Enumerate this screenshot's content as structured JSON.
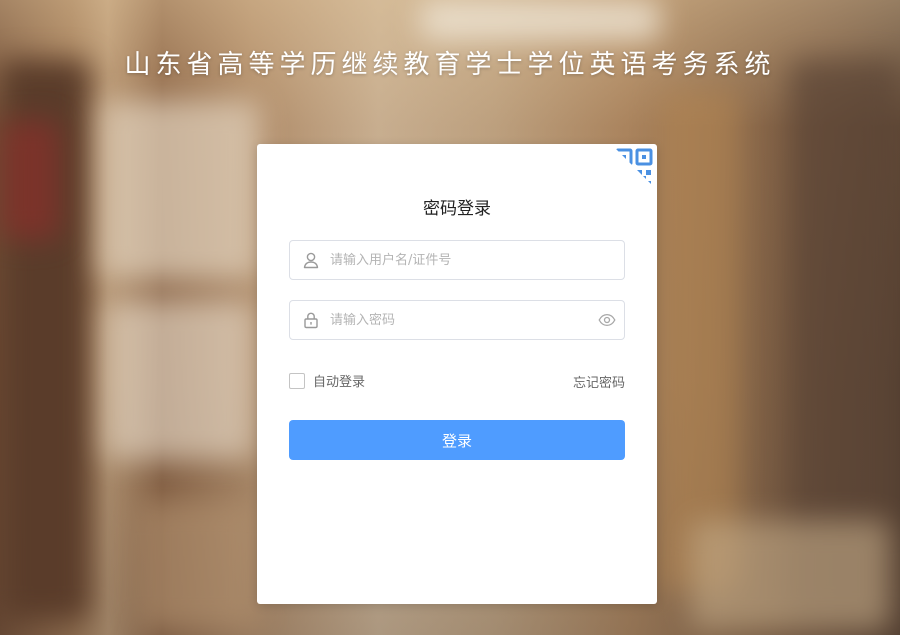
{
  "page": {
    "title": "山东省高等学历继续教育学士学位英语考务系统"
  },
  "login": {
    "heading": "密码登录",
    "username": {
      "value": "",
      "placeholder": "请输入用户名/证件号",
      "icon": "user-icon"
    },
    "password": {
      "value": "",
      "placeholder": "请输入密码",
      "icon": "lock-icon",
      "toggle_icon": "eye-icon"
    },
    "remember_label": "自动登录",
    "remember_checked": false,
    "forgot_label": "忘记密码",
    "submit_label": "登录",
    "qr_toggle_icon": "qr-code-icon"
  },
  "colors": {
    "accent": "#4f9cff",
    "qr_icon": "#4a90e2",
    "text_muted": "#666666",
    "placeholder": "#b4b4b4"
  }
}
